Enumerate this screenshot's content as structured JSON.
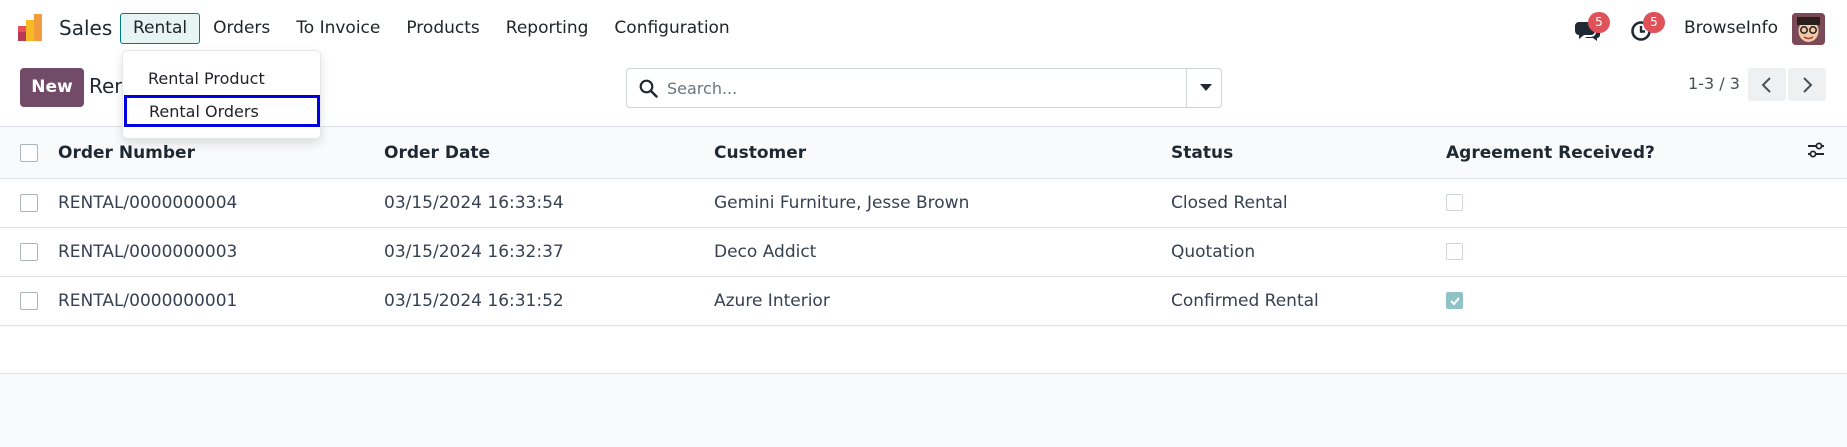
{
  "app": {
    "name": "Sales"
  },
  "menu": [
    "Rental",
    "Orders",
    "To Invoice",
    "Products",
    "Reporting",
    "Configuration"
  ],
  "dropdown": {
    "items": [
      "Rental Product",
      "Rental Orders"
    ]
  },
  "systray": {
    "messages_count": "5",
    "activities_count": "5",
    "user_name": "BrowseInfo"
  },
  "control": {
    "new_label": "New",
    "breadcrumb": "Rental Orders",
    "search_placeholder": "Search...",
    "pager": "1-3 / 3"
  },
  "table": {
    "columns": [
      "Order Number",
      "Order Date",
      "Customer",
      "Status",
      "Agreement Received?"
    ],
    "rows": [
      {
        "order": "RENTAL/0000000004",
        "date": "03/15/2024 16:33:54",
        "customer": "Gemini Furniture, Jesse Brown",
        "status": "Closed Rental",
        "agreement": false
      },
      {
        "order": "RENTAL/0000000003",
        "date": "03/15/2024 16:32:37",
        "customer": "Deco Addict",
        "status": "Quotation",
        "agreement": false
      },
      {
        "order": "RENTAL/0000000001",
        "date": "03/15/2024 16:31:52",
        "customer": "Azure Interior",
        "status": "Confirmed Rental",
        "agreement": true
      }
    ]
  },
  "colors": {
    "brand": "#714b67",
    "accent": "#017e84",
    "focus_outline": "#0000e0",
    "badge": "#e0525a"
  }
}
